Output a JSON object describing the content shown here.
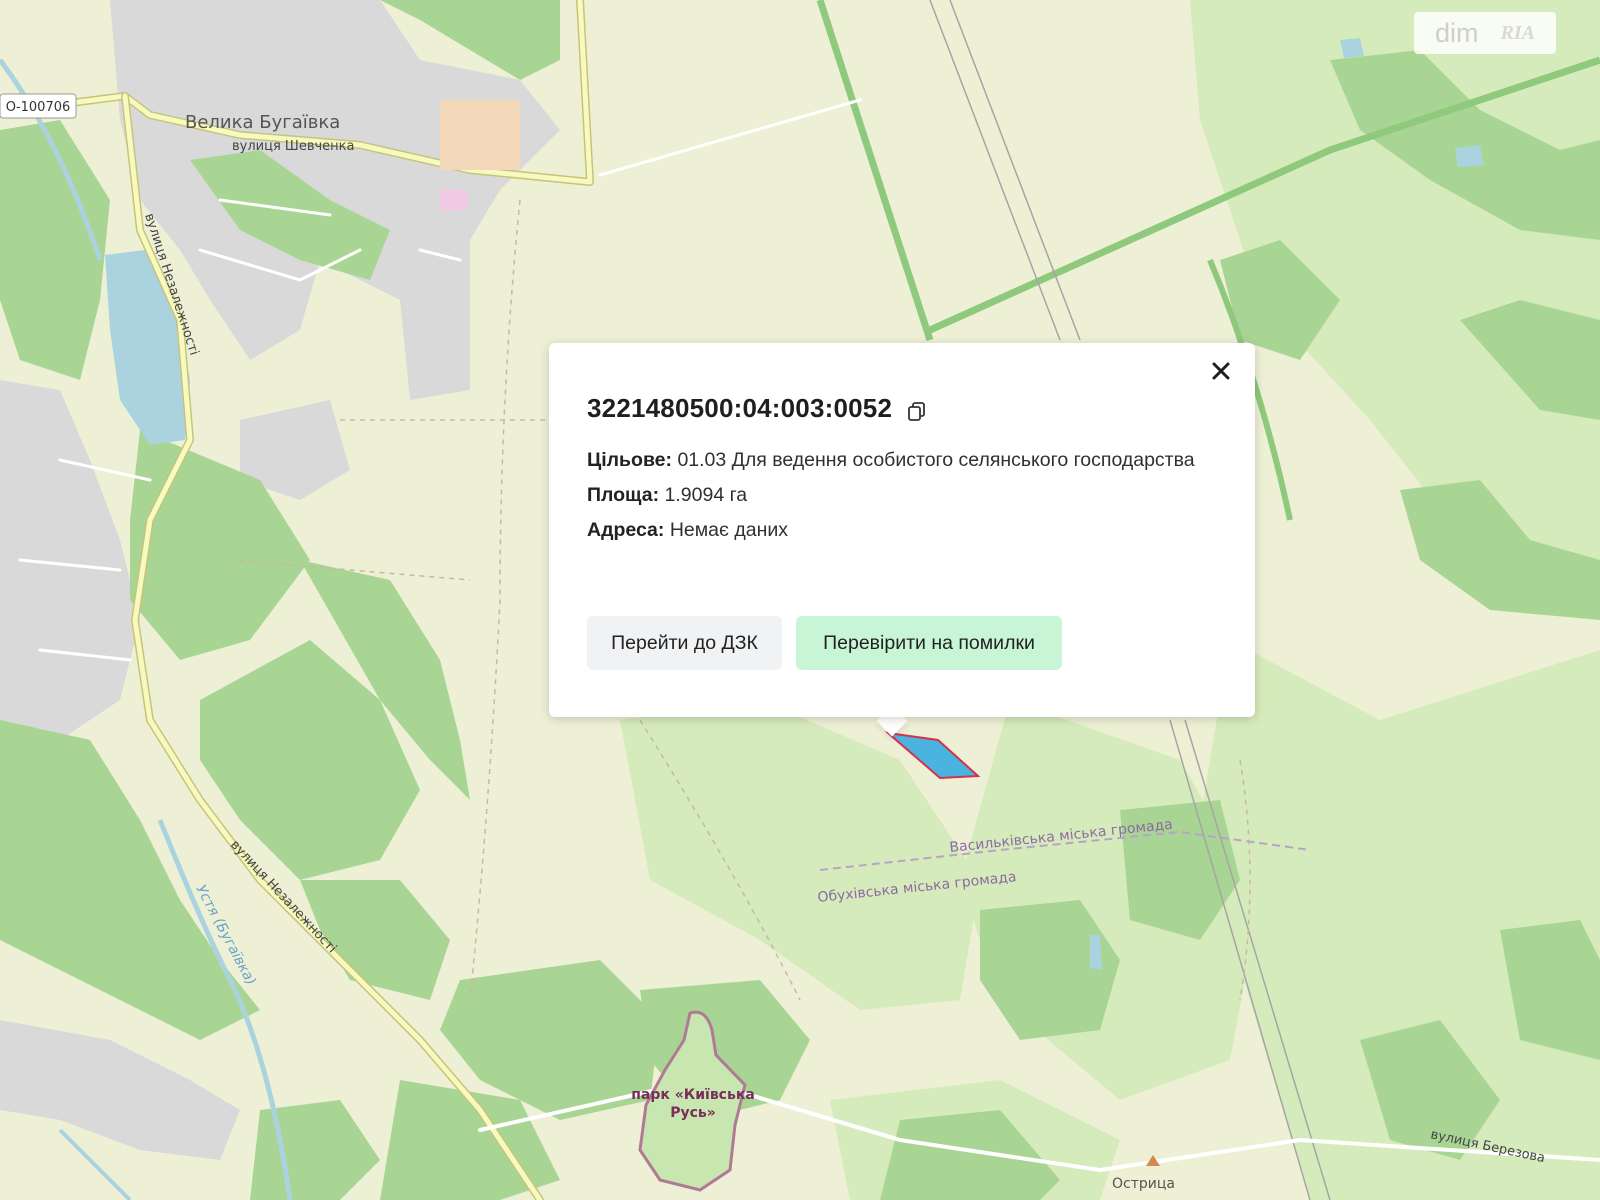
{
  "map": {
    "labels": {
      "village": "Велика Бугаївка",
      "road_code": "О-100706",
      "street_shevchenka": "вулиця Шевченка",
      "street_nezalezhnosti_north": "вулиця Незалежності",
      "street_nezalezhnosti_south": "вулиця Незалежності",
      "river": "Устя (Бугаївка)",
      "community_vasylkiv": "Васильківська міська громада",
      "community_obukhiv": "Обухівська міська громада",
      "park_line1": "парк «Київська",
      "park_line2": "Русь»",
      "street_berezova": "вулиця Березова",
      "peak": "Острица"
    },
    "colors": {
      "background": "#eef0d6",
      "forest": "#a9d594",
      "forest_dark": "#8fc97d",
      "meadow": "#cfe6b4",
      "residential": "#dcdcdc",
      "water": "#aad3df",
      "road_primary": "#f7fabf",
      "parcel_fill": "#4ab3df",
      "parcel_stroke": "#d6314a",
      "boundary_label": "#8e6aa3"
    }
  },
  "popup": {
    "cadastral_number": "3221480500:04:003:0052",
    "purpose_label": "Цільове:",
    "purpose_value": "01.03 Для ведення особистого селянського господарства",
    "area_label": "Площа:",
    "area_value": "1.9094 га",
    "address_label": "Адреса:",
    "address_value": "Немає даних",
    "btn_dzk": "Перейти до ДЗК",
    "btn_check": "Перевірити на помилки"
  },
  "watermark": {
    "dim": "dim",
    "ria": "RIA"
  }
}
